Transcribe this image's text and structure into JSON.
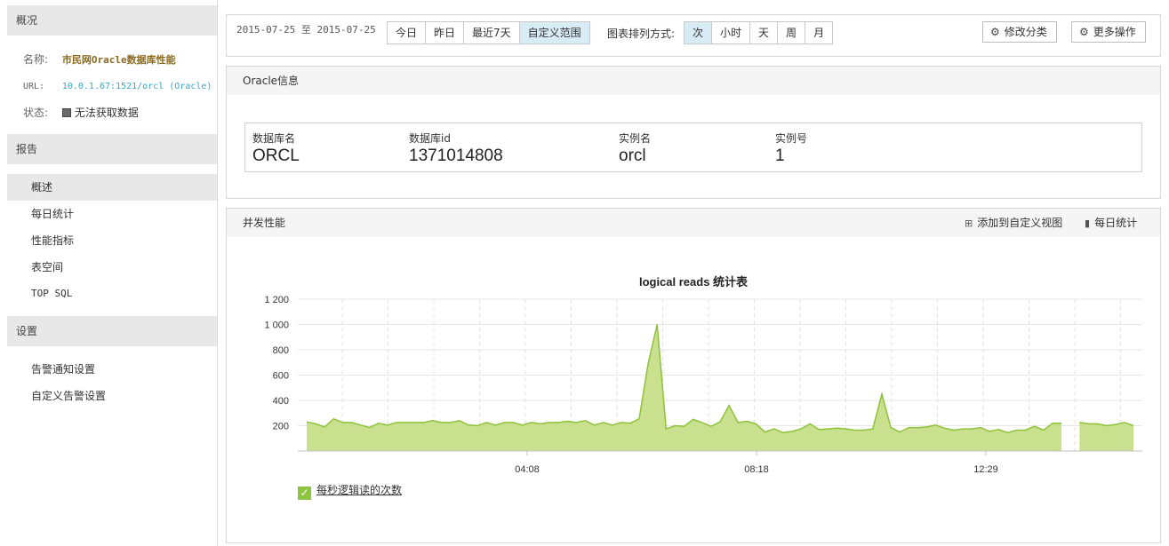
{
  "sidebar": {
    "overview_header": "概况",
    "name_key": "名称:",
    "name_value": "市民网Oracle数据库性能",
    "url_key": "URL:",
    "url_value": "10.0.1.67:1521/orcl (Oracle)",
    "status_key": "状态:",
    "status_value": "无法获取数据",
    "report_header": "报告",
    "report_items": [
      "概述",
      "每日统计",
      "性能指标",
      "表空间",
      "TOP SQL"
    ],
    "settings_header": "设置",
    "settings_items": [
      "告警通知设置",
      "自定义告警设置"
    ]
  },
  "toolbar": {
    "date_range": "2015-07-25 至 2015-07-25",
    "range_buttons": [
      "今日",
      "昨日",
      "最近7天",
      "自定义范围"
    ],
    "range_selected": "自定义范围",
    "sort_label": "图表排列方式:",
    "sort_buttons": [
      "次",
      "小时",
      "天",
      "周",
      "月"
    ],
    "sort_selected": "次",
    "edit_category": "修改分类",
    "more_actions": "更多操作"
  },
  "oracle_info": {
    "title": "Oracle信息",
    "fields": [
      {
        "label": "数据库名",
        "value": "ORCL"
      },
      {
        "label": "数据库id",
        "value": "1371014808"
      },
      {
        "label": "实例名",
        "value": "orcl"
      },
      {
        "label": "实例号",
        "value": "1"
      }
    ]
  },
  "performance": {
    "title": "并发性能",
    "add_to_view": "添加到自定义视图",
    "daily_stats": "每日统计"
  },
  "colors": {
    "area_fill": "#c9e08f",
    "area_line": "#8fc23a",
    "selected_bg": "#d8ecf6"
  },
  "chart_data": {
    "type": "area",
    "title": "logical reads 统计表",
    "ylim": [
      0,
      1200
    ],
    "yticks": [
      "1 200",
      "1 000",
      "800",
      "600",
      "400",
      "200"
    ],
    "ytick_values": [
      1200,
      1000,
      800,
      600,
      400,
      200
    ],
    "xticks": [
      "04:08",
      "08:18",
      "12:29"
    ],
    "legend_position": "bottom-left",
    "series": [
      {
        "name": "每秒逻辑读的次数",
        "segments": [
          [
            230,
            215,
            190,
            255,
            225,
            225,
            205,
            185,
            220,
            205,
            225,
            225,
            225,
            225,
            240,
            225,
            225,
            240,
            205,
            200,
            225,
            205,
            225,
            225,
            205,
            225,
            215,
            225,
            225,
            235,
            225,
            240,
            205,
            225,
            205,
            225,
            220,
            255,
            690,
            1000,
            175,
            200,
            195,
            250,
            225,
            195,
            230,
            360,
            225,
            235,
            215,
            150,
            175,
            145,
            155,
            175,
            215,
            170,
            175,
            180,
            175,
            165,
            165,
            175,
            450,
            185,
            150,
            185,
            185,
            190,
            205,
            180,
            165,
            175,
            175,
            185,
            155,
            170,
            145,
            165,
            165,
            195,
            165,
            220,
            220
          ],
          [
            225,
            215,
            215,
            200,
            210,
            225,
            200
          ]
        ]
      }
    ]
  }
}
